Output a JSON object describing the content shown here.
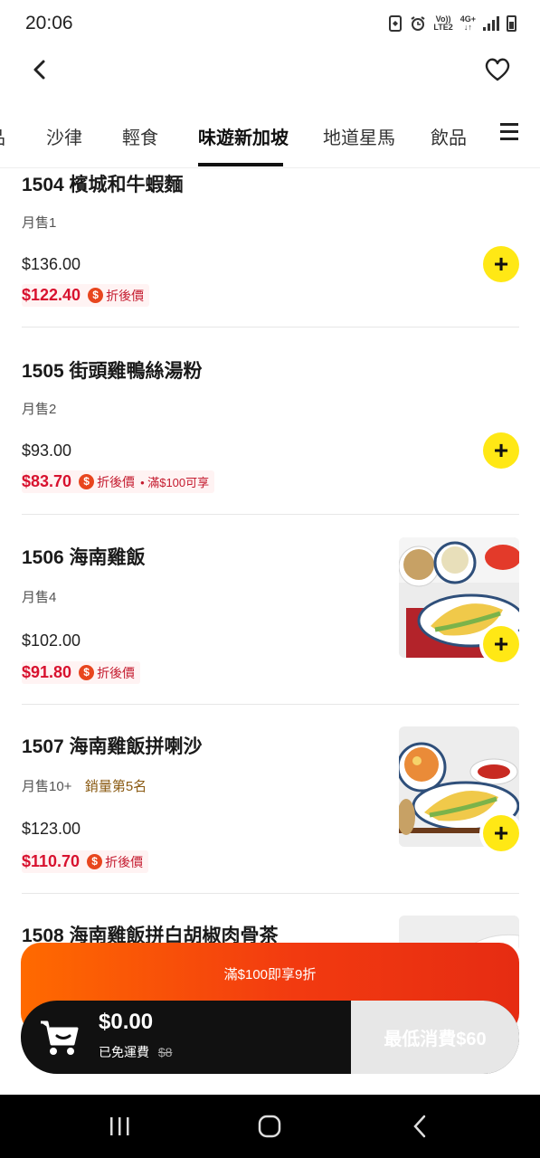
{
  "status_bar": {
    "time": "20:06",
    "icons": [
      "nfc-icon",
      "alarm-icon",
      "volte-icon",
      "4g-icon",
      "signal-icon",
      "battery-icon"
    ],
    "volte_label": "Vo))",
    "lte_label": "LTE2",
    "net_label": "4G+"
  },
  "tabs": [
    {
      "label": "品"
    },
    {
      "label": "沙律"
    },
    {
      "label": "輕食"
    },
    {
      "label": "味遊新加坡",
      "active": true
    },
    {
      "label": "地道星馬"
    },
    {
      "label": "飲品"
    }
  ],
  "items": [
    {
      "name": "1504 檳城和牛蝦麵",
      "sold": "月售1",
      "price": "$136.00",
      "discount": "$122.40",
      "tag": "折後價",
      "extra": ""
    },
    {
      "name": "1505 街頭雞鴨絲湯粉",
      "sold": "月售2",
      "price": "$93.00",
      "discount": "$83.70",
      "tag": "折後價",
      "extra": "• 滿$100可享"
    },
    {
      "name": "1506 海南雞飯",
      "sold": "月售4",
      "price": "$102.00",
      "discount": "$91.80",
      "tag": "折後價",
      "extra": ""
    },
    {
      "name": "1507 海南雞飯拼喇沙",
      "sold": "月售10+",
      "rank": "銷量第5名",
      "price": "$123.00",
      "discount": "$110.70",
      "tag": "折後價",
      "extra": ""
    },
    {
      "name": "1508 海南雞飯拼白胡椒肉骨茶"
    }
  ],
  "promo_bar": {
    "text": "滿$100即享9折"
  },
  "cart": {
    "total": "$0.00",
    "delivery_label": "已免運費",
    "delivery_original": "$8",
    "min_spend": "最低消費$60"
  },
  "colors": {
    "accent_yellow": "#ffe815",
    "discount_red": "#d8112e",
    "promo_orange": "#ff6a00",
    "cart_black": "#111111"
  },
  "coin_symbol": "$",
  "add_symbol": "+"
}
